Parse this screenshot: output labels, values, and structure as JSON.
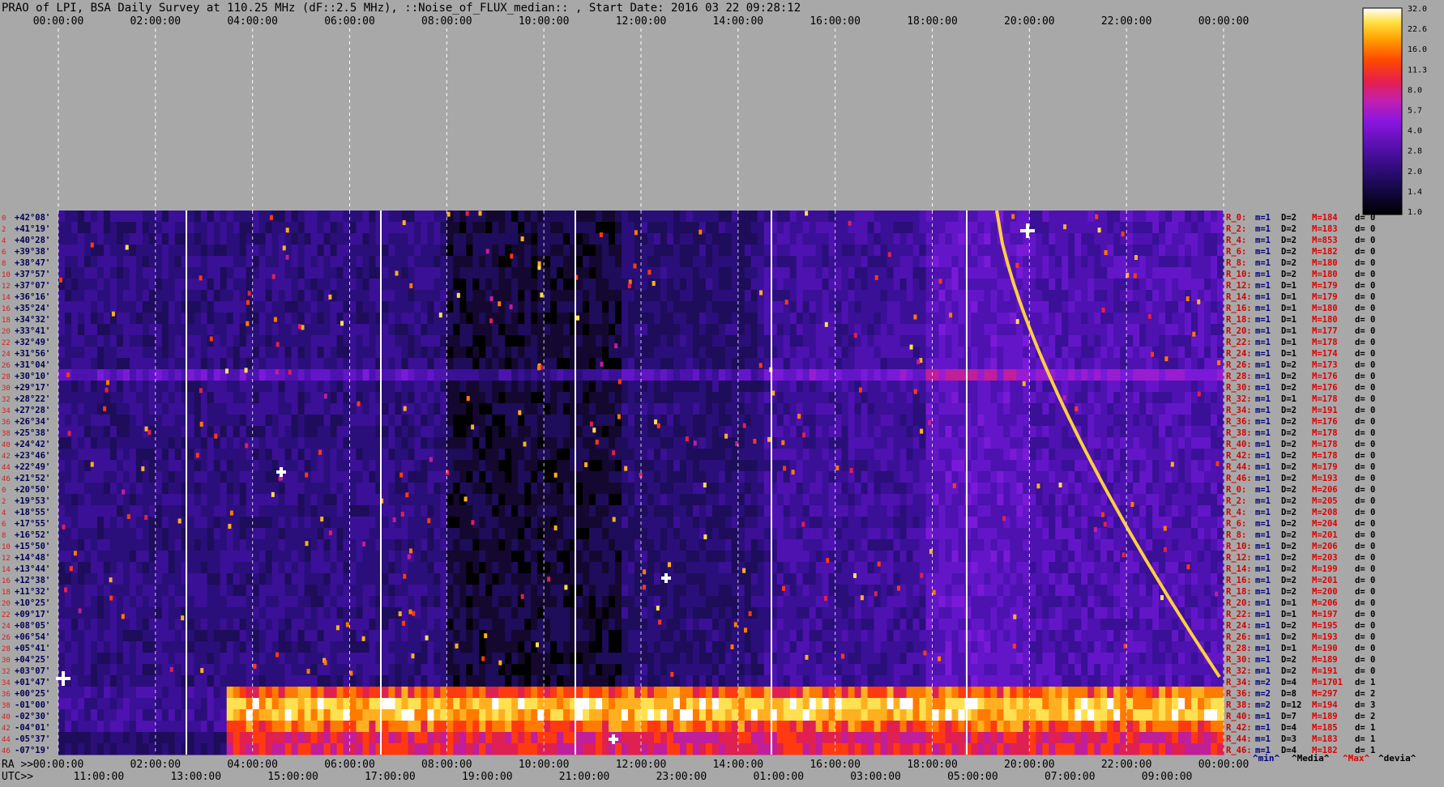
{
  "window": {
    "title": "PRAO of LPI, BSA Daily Survey at 110.25 MHz (dF::2.5 MHz), ::Noise_of_FLUX_median:: , Start Date: 2016 03 22 09:28:12"
  },
  "chart_data": {
    "type": "heatmap",
    "title": "PRAO of LPI, BSA Daily Survey at 110.25 MHz (dF::2.5 MHz), ::Noise_of_FLUX_median:: , Start Date: 2016 03 22 09:28:12",
    "x_top_ticks": [
      "00:00:00",
      "02:00:00",
      "04:00:00",
      "06:00:00",
      "08:00:00",
      "10:00:00",
      "12:00:00",
      "14:00:00",
      "16:00:00",
      "18:00:00",
      "20:00:00",
      "22:00:00",
      "00:00:00"
    ],
    "x_bottom_label_ra": "RA >>",
    "x_bottom_ra_ticks": [
      "00:00:00",
      "02:00:00",
      "04:00:00",
      "06:00:00",
      "08:00:00",
      "10:00:00",
      "12:00:00",
      "14:00:00",
      "16:00:00",
      "18:00:00",
      "20:00:00",
      "22:00:00",
      "00:00:00"
    ],
    "x_bottom_label_utc": "UTC>>",
    "x_bottom_utc_ticks": [
      "11:00:00",
      "13:00:00",
      "15:00:00",
      "17:00:00",
      "19:00:00",
      "21:00:00",
      "23:00:00",
      "01:00:00",
      "03:00:00",
      "05:00:00",
      "07:00:00",
      "09:00:00"
    ],
    "beam_index_labels": [
      "0",
      "2",
      "4",
      "6",
      "8",
      "10",
      "12",
      "14",
      "16",
      "18",
      "20",
      "22",
      "24",
      "26",
      "28",
      "30",
      "32",
      "34",
      "36",
      "38",
      "40",
      "42",
      "44",
      "46",
      "0",
      "2",
      "4",
      "6",
      "8",
      "10",
      "12",
      "14",
      "16",
      "18",
      "20",
      "22",
      "24",
      "26",
      "28",
      "30",
      "32",
      "34",
      "36",
      "38",
      "40",
      "42",
      "44",
      "46"
    ],
    "declinations": [
      "+42°08'",
      "+41°19'",
      "+40°28'",
      "+39°38'",
      "+38°47'",
      "+37°57'",
      "+37°07'",
      "+36°16'",
      "+35°24'",
      "+34°32'",
      "+33°41'",
      "+32°49'",
      "+31°56'",
      "+31°04'",
      "+30°10'",
      "+29°17'",
      "+28°22'",
      "+27°28'",
      "+26°34'",
      "+25°38'",
      "+24°42'",
      "+23°46'",
      "+22°49'",
      "+21°52'",
      "+20°50'",
      "+19°53'",
      "+18°55'",
      "+17°55'",
      "+16°52'",
      "+15°50'",
      "+14°48'",
      "+13°44'",
      "+12°38'",
      "+11°32'",
      "+10°25'",
      "+09°17'",
      "+08°05'",
      "+06°54'",
      "+05°41'",
      "+04°25'",
      "+03°07'",
      "+01°47'",
      "+00°25'",
      "-01°00'",
      "-02°30'",
      "-04°01'",
      "-05°37'",
      "-07°19'"
    ],
    "beam_stats_header": [
      "^min^",
      "^Media^",
      "^Max^",
      "^devia^"
    ],
    "beam_stats": [
      {
        "beam": "R_0:",
        "min": "m=1",
        "med": "D=2",
        "max": "M=184",
        "dev": "d= 0"
      },
      {
        "beam": "R_2:",
        "min": "m=1",
        "med": "D=2",
        "max": "M=183",
        "dev": "d= 0"
      },
      {
        "beam": "R_4:",
        "min": "m=1",
        "med": "D=2",
        "max": "M=853",
        "dev": "d= 0"
      },
      {
        "beam": "R_6:",
        "min": "m=1",
        "med": "D=2",
        "max": "M=182",
        "dev": "d= 0"
      },
      {
        "beam": "R_8:",
        "min": "m=1",
        "med": "D=2",
        "max": "M=180",
        "dev": "d= 0"
      },
      {
        "beam": "R_10:",
        "min": "m=1",
        "med": "D=2",
        "max": "M=180",
        "dev": "d= 0"
      },
      {
        "beam": "R_12:",
        "min": "m=1",
        "med": "D=1",
        "max": "M=179",
        "dev": "d= 0"
      },
      {
        "beam": "R_14:",
        "min": "m=1",
        "med": "D=1",
        "max": "M=179",
        "dev": "d= 0"
      },
      {
        "beam": "R_16:",
        "min": "m=1",
        "med": "D=1",
        "max": "M=180",
        "dev": "d= 0"
      },
      {
        "beam": "R_18:",
        "min": "m=1",
        "med": "D=1",
        "max": "M=180",
        "dev": "d= 0"
      },
      {
        "beam": "R_20:",
        "min": "m=1",
        "med": "D=1",
        "max": "M=177",
        "dev": "d= 0"
      },
      {
        "beam": "R_22:",
        "min": "m=1",
        "med": "D=1",
        "max": "M=178",
        "dev": "d= 0"
      },
      {
        "beam": "R_24:",
        "min": "m=1",
        "med": "D=1",
        "max": "M=174",
        "dev": "d= 0"
      },
      {
        "beam": "R_26:",
        "min": "m=1",
        "med": "D=2",
        "max": "M=173",
        "dev": "d= 0"
      },
      {
        "beam": "R_28:",
        "min": "m=1",
        "med": "D=2",
        "max": "M=176",
        "dev": "d= 0"
      },
      {
        "beam": "R_30:",
        "min": "m=1",
        "med": "D=2",
        "max": "M=176",
        "dev": "d= 0"
      },
      {
        "beam": "R_32:",
        "min": "m=1",
        "med": "D=1",
        "max": "M=178",
        "dev": "d= 0"
      },
      {
        "beam": "R_34:",
        "min": "m=1",
        "med": "D=2",
        "max": "M=191",
        "dev": "d= 0"
      },
      {
        "beam": "R_36:",
        "min": "m=1",
        "med": "D=2",
        "max": "M=176",
        "dev": "d= 0"
      },
      {
        "beam": "R_38:",
        "min": "m=1",
        "med": "D=2",
        "max": "M=178",
        "dev": "d= 0"
      },
      {
        "beam": "R_40:",
        "min": "m=1",
        "med": "D=2",
        "max": "M=178",
        "dev": "d= 0"
      },
      {
        "beam": "R_42:",
        "min": "m=1",
        "med": "D=2",
        "max": "M=178",
        "dev": "d= 0"
      },
      {
        "beam": "R_44:",
        "min": "m=1",
        "med": "D=2",
        "max": "M=179",
        "dev": "d= 0"
      },
      {
        "beam": "R_46:",
        "min": "m=1",
        "med": "D=2",
        "max": "M=193",
        "dev": "d= 0"
      },
      {
        "beam": "R_0:",
        "min": "m=1",
        "med": "D=2",
        "max": "M=206",
        "dev": "d= 0"
      },
      {
        "beam": "R_2:",
        "min": "m=1",
        "med": "D=2",
        "max": "M=205",
        "dev": "d= 0"
      },
      {
        "beam": "R_4:",
        "min": "m=1",
        "med": "D=2",
        "max": "M=208",
        "dev": "d= 0"
      },
      {
        "beam": "R_6:",
        "min": "m=1",
        "med": "D=2",
        "max": "M=204",
        "dev": "d= 0"
      },
      {
        "beam": "R_8:",
        "min": "m=1",
        "med": "D=2",
        "max": "M=201",
        "dev": "d= 0"
      },
      {
        "beam": "R_10:",
        "min": "m=1",
        "med": "D=2",
        "max": "M=206",
        "dev": "d= 0"
      },
      {
        "beam": "R_12:",
        "min": "m=1",
        "med": "D=2",
        "max": "M=203",
        "dev": "d= 0"
      },
      {
        "beam": "R_14:",
        "min": "m=1",
        "med": "D=2",
        "max": "M=199",
        "dev": "d= 0"
      },
      {
        "beam": "R_16:",
        "min": "m=1",
        "med": "D=2",
        "max": "M=201",
        "dev": "d= 0"
      },
      {
        "beam": "R_18:",
        "min": "m=1",
        "med": "D=2",
        "max": "M=200",
        "dev": "d= 0"
      },
      {
        "beam": "R_20:",
        "min": "m=1",
        "med": "D=1",
        "max": "M=206",
        "dev": "d= 0"
      },
      {
        "beam": "R_22:",
        "min": "m=1",
        "med": "D=1",
        "max": "M=197",
        "dev": "d= 0"
      },
      {
        "beam": "R_24:",
        "min": "m=1",
        "med": "D=2",
        "max": "M=195",
        "dev": "d= 0"
      },
      {
        "beam": "R_26:",
        "min": "m=1",
        "med": "D=2",
        "max": "M=193",
        "dev": "d= 0"
      },
      {
        "beam": "R_28:",
        "min": "m=1",
        "med": "D=1",
        "max": "M=190",
        "dev": "d= 0"
      },
      {
        "beam": "R_30:",
        "min": "m=1",
        "med": "D=2",
        "max": "M=189",
        "dev": "d= 0"
      },
      {
        "beam": "R_32:",
        "min": "m=1",
        "med": "D=2",
        "max": "M=191",
        "dev": "d= 0"
      },
      {
        "beam": "R_34:",
        "min": "m=2",
        "med": "D=4",
        "max": "M=1701",
        "dev": "d= 1"
      },
      {
        "beam": "R_36:",
        "min": "m=2",
        "med": "D=8",
        "max": "M=297",
        "dev": "d= 2"
      },
      {
        "beam": "R_38:",
        "min": "m=2",
        "med": "D=12",
        "max": "M=194",
        "dev": "d= 3"
      },
      {
        "beam": "R_40:",
        "min": "m=1",
        "med": "D=7",
        "max": "M=189",
        "dev": "d= 2"
      },
      {
        "beam": "R_42:",
        "min": "m=1",
        "med": "D=4",
        "max": "M=185",
        "dev": "d= 1"
      },
      {
        "beam": "R_44:",
        "min": "m=1",
        "med": "D=3",
        "max": "M=183",
        "dev": "d= 1"
      },
      {
        "beam": "R_46:",
        "min": "m=1",
        "med": "D=4",
        "max": "M=182",
        "dev": "d= 1"
      }
    ],
    "colorbar": {
      "scale": "log",
      "ticks": [
        "32.0",
        "22.6",
        "16.0",
        "11.3",
        "8.0",
        "5.7",
        "4.0",
        "2.8",
        "2.0",
        "1.4",
        "1.0"
      ]
    },
    "colors": {
      "background": "#a8a8a8",
      "beam_index": "#d22020",
      "declination": "#000055",
      "stat_beam": "#d20000",
      "stat_min": "#000080",
      "stat_med": "#000000",
      "stat_max": "#e00000",
      "stat_dev": "#000000"
    }
  }
}
